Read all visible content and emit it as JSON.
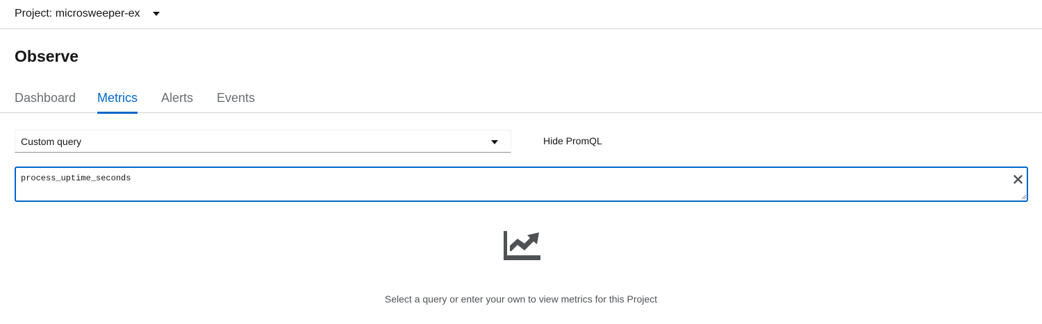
{
  "project": {
    "label": "Project: microsweeper-ex",
    "icon": "caret-down-icon"
  },
  "page": {
    "title": "Observe"
  },
  "tabs": [
    {
      "label": "Dashboard",
      "active": false
    },
    {
      "label": "Metrics",
      "active": true
    },
    {
      "label": "Alerts",
      "active": false
    },
    {
      "label": "Events",
      "active": false
    }
  ],
  "query_select": {
    "selected": "Custom query",
    "icon": "caret-down-icon"
  },
  "toggle_promql": {
    "label": "Hide PromQL"
  },
  "query_input": {
    "value": "process_uptime_seconds",
    "clear_icon": "close-icon"
  },
  "empty_state": {
    "icon": "chart-area-icon",
    "message": "Select a query or enter your own to view metrics for this Project"
  },
  "colors": {
    "accent": "#0066cc",
    "text": "#151515",
    "muted": "#6a6e73",
    "icon": "#4f5255",
    "border": "#d2d2d2"
  }
}
